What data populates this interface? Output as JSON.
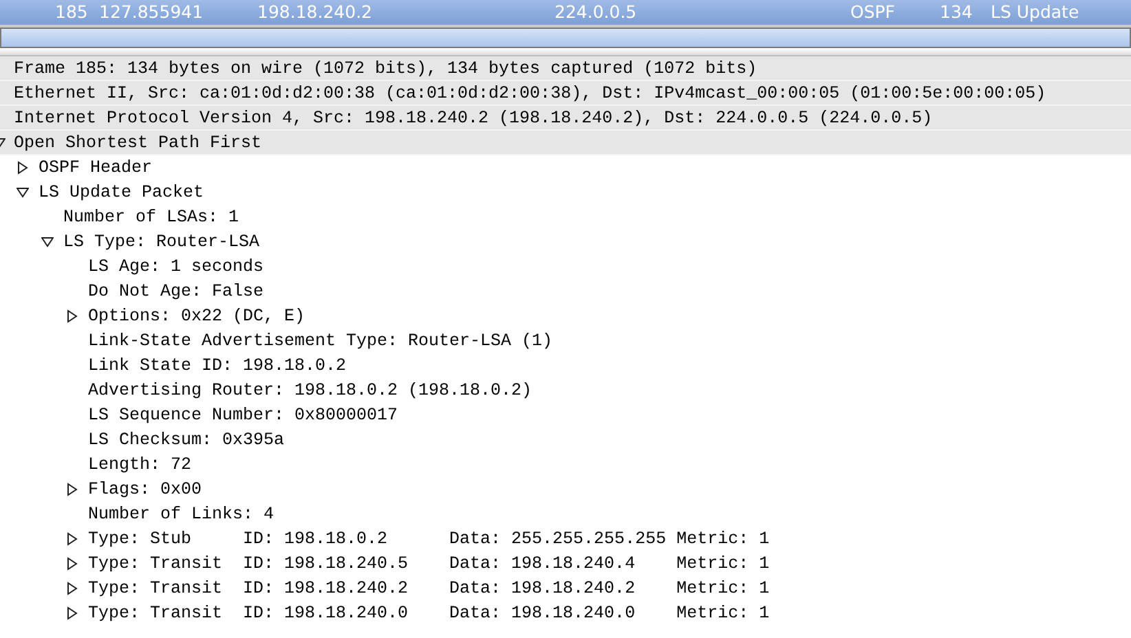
{
  "packet_row": {
    "selected": true,
    "no": "185",
    "time": "127.855941",
    "source": "198.18.240.2",
    "destination": "224.0.0.5",
    "protocol": "OSPF",
    "length": "134",
    "info": "LS Update"
  },
  "tree": [
    {
      "label": "Frame 185: 134 bytes on wire (1072 bits), 134 bytes captured (1072 bits)"
    },
    {
      "label": "Ethernet II, Src: ca:01:0d:d2:00:38 (ca:01:0d:d2:00:38), Dst: IPv4mcast_00:00:05 (01:00:5e:00:00:05)"
    },
    {
      "label": "Internet Protocol Version 4, Src: 198.18.240.2 (198.18.240.2), Dst: 224.0.0.5 (224.0.0.5)"
    },
    {
      "label": "Open Shortest Path First",
      "expanded": true,
      "children": [
        {
          "label": "OSPF Header",
          "expanded": false
        },
        {
          "label": "LS Update Packet",
          "expanded": true,
          "children": [
            {
              "label": "Number of LSAs: 1"
            },
            {
              "label": "LS Type: Router-LSA",
              "expanded": true,
              "children": [
                {
                  "label": "LS Age: 1 seconds"
                },
                {
                  "label": "Do Not Age: False"
                },
                {
                  "label": "Options: 0x22 (DC, E)",
                  "expanded": false
                },
                {
                  "label": "Link-State Advertisement Type: Router-LSA (1)"
                },
                {
                  "label": "Link State ID: 198.18.0.2"
                },
                {
                  "label": "Advertising Router: 198.18.0.2 (198.18.0.2)"
                },
                {
                  "label": "LS Sequence Number: 0x80000017"
                },
                {
                  "label": "LS Checksum: 0x395a"
                },
                {
                  "label": "Length: 72"
                },
                {
                  "label": "Flags: 0x00",
                  "expanded": false
                },
                {
                  "label": "Number of Links: 4"
                },
                {
                  "label": "Type: Stub     ID: 198.18.0.2      Data: 255.255.255.255 Metric: 1",
                  "expanded": false
                },
                {
                  "label": "Type: Transit  ID: 198.18.240.5    Data: 198.18.240.4    Metric: 1",
                  "expanded": false
                },
                {
                  "label": "Type: Transit  ID: 198.18.240.2    Data: 198.18.240.2    Metric: 1",
                  "expanded": false
                },
                {
                  "label": "Type: Transit  ID: 198.18.240.0    Data: 198.18.240.0    Metric: 1",
                  "expanded": false
                }
              ]
            }
          ]
        }
      ]
    }
  ]
}
